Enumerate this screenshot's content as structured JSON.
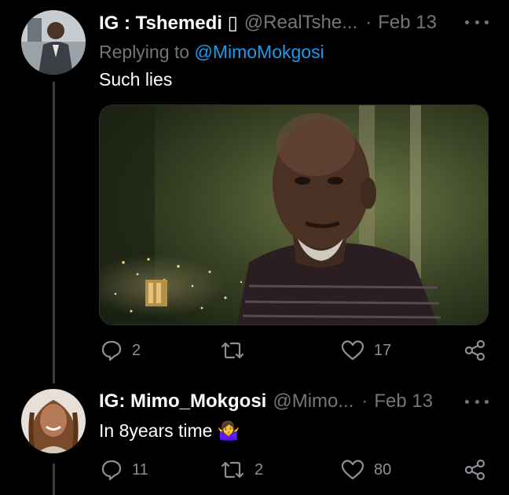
{
  "colors": {
    "background": "#000000",
    "muted": "#71767b",
    "link": "#1d9bf0",
    "thread_line": "#3a3d42"
  },
  "tweets": [
    {
      "display_name": "IG : Tshemedi ▯",
      "handle": "@RealTshe...",
      "separator": "·",
      "date": "Feb 13",
      "replying_prefix": "Replying to ",
      "replying_to": "@MimoMokgosi",
      "text": "Such lies",
      "media": {
        "type": "image",
        "description_icon": "video-still",
        "logo": "network-logo"
      },
      "actions": {
        "reply_count": "2",
        "retweet_count": "",
        "like_count": "17"
      },
      "icons": {
        "reply": "comment-icon",
        "retweet": "retweet-icon",
        "like": "heart-icon",
        "share": "share-icon"
      }
    },
    {
      "display_name": "IG: Mimo_Mokgosi",
      "handle": "@Mimo...",
      "separator": "·",
      "date": "Feb 13",
      "text": "In 8years time",
      "emoji": "🤷‍♀️",
      "actions": {
        "reply_count": "11",
        "retweet_count": "2",
        "like_count": "80"
      },
      "icons": {
        "reply": "comment-icon",
        "retweet": "retweet-icon",
        "like": "heart-icon",
        "share": "share-icon"
      }
    }
  ]
}
